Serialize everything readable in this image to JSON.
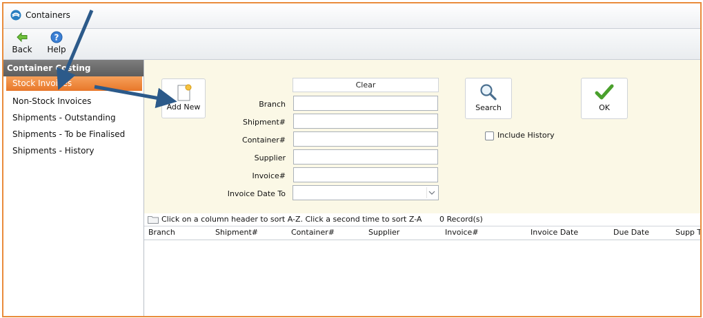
{
  "window": {
    "title": "Containers"
  },
  "toolbar": {
    "back_label": "Back",
    "help_label": "Help"
  },
  "sidebar": {
    "header": "Container Costing",
    "items": [
      {
        "label": "Stock Invoices",
        "active": true
      },
      {
        "label": "Non-Stock Invoices"
      },
      {
        "label": "Shipments - Outstanding"
      },
      {
        "label": "Shipments - To be Finalised"
      },
      {
        "label": "Shipments - History"
      }
    ]
  },
  "form": {
    "add_new_label": "Add New",
    "clear_label": "Clear",
    "search_label": "Search",
    "ok_label": "OK",
    "include_history_label": "Include History",
    "include_history_checked": false,
    "fields": [
      {
        "label": "Branch",
        "value": ""
      },
      {
        "label": "Shipment#",
        "value": ""
      },
      {
        "label": "Container#",
        "value": ""
      },
      {
        "label": "Supplier",
        "value": ""
      },
      {
        "label": "Invoice#",
        "value": ""
      }
    ],
    "invoice_date_to": {
      "label": "Invoice Date To",
      "value": ""
    }
  },
  "grid": {
    "sort_hint": "Click on a column header to sort A-Z. Click a second time to sort Z-A",
    "record_count": "0 Record(s)",
    "columns": [
      "Branch",
      "Shipment#",
      "Container#",
      "Supplier",
      "Invoice#",
      "Invoice Date",
      "Due Date",
      "Supp T"
    ],
    "rows": []
  },
  "colors": {
    "accent_orange": "#e8772a",
    "form_background": "#fbf8e6",
    "annotation_arrow": "#2c5a8a"
  },
  "icons": {
    "app": "containers-app-icon",
    "back": "back-arrow-icon",
    "help": "help-icon",
    "add_new": "new-document-icon",
    "search": "magnifier-icon",
    "ok": "checkmark-icon",
    "folder": "folder-icon"
  }
}
